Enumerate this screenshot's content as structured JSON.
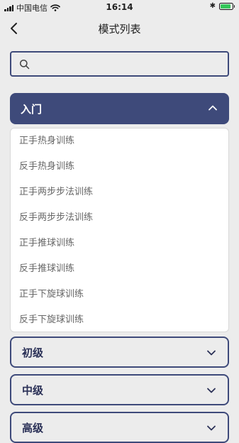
{
  "status_bar": {
    "carrier": "中国电信",
    "time": "16:14",
    "battery_level": 0.9,
    "battery_color": "#34c759"
  },
  "nav": {
    "title": "模式列表",
    "back_icon": "chevron-left-icon"
  },
  "search": {
    "value": "",
    "placeholder": "",
    "icon": "search-icon"
  },
  "colors": {
    "accent": "#3e4a7a",
    "background": "#ececec",
    "list_text": "#666666"
  },
  "sections": [
    {
      "label": "入门",
      "expanded": true,
      "items": [
        "正手热身训练",
        "反手热身训练",
        "正手两步步法训练",
        "反手两步步法训练",
        "正手推球训练",
        "反手推球训练",
        "正手下旋球训练",
        "反手下旋球训练"
      ]
    },
    {
      "label": "初级",
      "expanded": false
    },
    {
      "label": "中级",
      "expanded": false
    },
    {
      "label": "高级",
      "expanded": false
    }
  ]
}
